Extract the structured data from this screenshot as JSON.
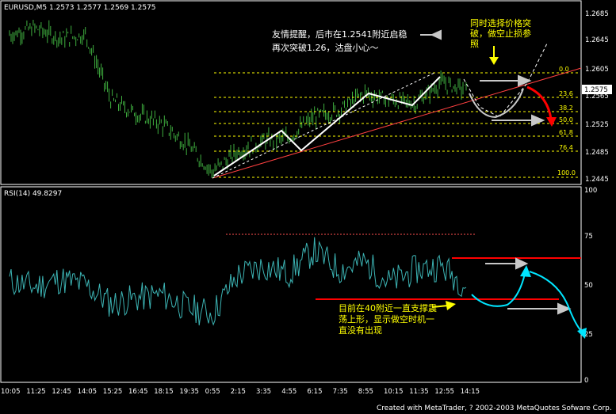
{
  "colors": {
    "background": "#000000",
    "frame": "#ffffff",
    "price_bars": "#3fae3f",
    "rsi_line": "#3cb4b4",
    "annotation_yellow": "#ffff00",
    "trend_red": "#ff0000",
    "arrow_cyan": "#00e5ff",
    "fib_dashed": "#ffff00"
  },
  "price_panel": {
    "header": "EURUSD,M5  1.2573 1.2577 1.2569 1.2575",
    "current_price_label": "1.2575",
    "y_ticks": [
      "1.2685",
      "1.2645",
      "1.2605",
      "1.2565",
      "1.2525",
      "1.2485",
      "1.2445"
    ],
    "fib_labels": [
      "0.0",
      "23.6",
      "38.2",
      "50.0",
      "61.8",
      "76.4",
      "100.0"
    ],
    "note_white_line1": "友情提醒，后市在1.2541附近启稳",
    "note_white_line2": "再次突破1.26，沽盘小心～",
    "note_yellow_line1": "同时选择价格突",
    "note_yellow_line2": "破，做空止损参",
    "note_yellow_line3": "照"
  },
  "rsi_panel": {
    "header": "RSI(14)  49.8297",
    "y_ticks": [
      "100",
      "75",
      "50",
      "25",
      "0"
    ],
    "note_line1": "目前在40附近一直支撑震",
    "note_line2": "荡上形，显示做空时机一",
    "note_line3": "直没有出现"
  },
  "x_ticks": [
    "10:05",
    "11:25",
    "12:45",
    "14:05",
    "15:25",
    "16:45",
    "18:15",
    "19:35",
    "0:55",
    "2:15",
    "3:35",
    "4:55",
    "6:15",
    "7:35",
    "8:55",
    "10:15",
    "11:35",
    "12:55",
    "14:15"
  ],
  "credit": "Created with MetaTrader, ? 2002-2003 MetaQuotes Sofware Corp.",
  "chart_data": {
    "type": "line",
    "series": [
      {
        "name": "EURUSD,M5",
        "x": [
          "10:05",
          "11:25",
          "12:45",
          "14:05",
          "15:25",
          "16:45",
          "18:15",
          "19:35",
          "0:55",
          "2:15",
          "3:35",
          "4:55",
          "6:15",
          "7:35",
          "8:55",
          "10:15",
          "11:35",
          "12:55",
          "14:15"
        ],
        "values": [
          1.2655,
          1.2665,
          1.265,
          1.2655,
          1.256,
          1.254,
          1.2525,
          1.2495,
          1.2455,
          1.2485,
          1.25,
          1.2505,
          1.2535,
          1.2545,
          1.257,
          1.256,
          1.2555,
          1.2585,
          1.2575
        ]
      },
      {
        "name": "RSI(14)",
        "x": [
          "10:05",
          "11:25",
          "12:45",
          "14:05",
          "15:25",
          "16:45",
          "18:15",
          "19:35",
          "0:55",
          "2:15",
          "3:35",
          "4:55",
          "6:15",
          "7:35",
          "8:55",
          "10:15",
          "11:35",
          "12:55",
          "14:15"
        ],
        "values": [
          52,
          49,
          53,
          50,
          40,
          43,
          45,
          38,
          35,
          55,
          60,
          56,
          68,
          58,
          62,
          51,
          58,
          60,
          49.8
        ]
      }
    ],
    "ylim_price": [
      1.2445,
      1.2685
    ],
    "ylim_rsi": [
      0,
      100
    ]
  }
}
